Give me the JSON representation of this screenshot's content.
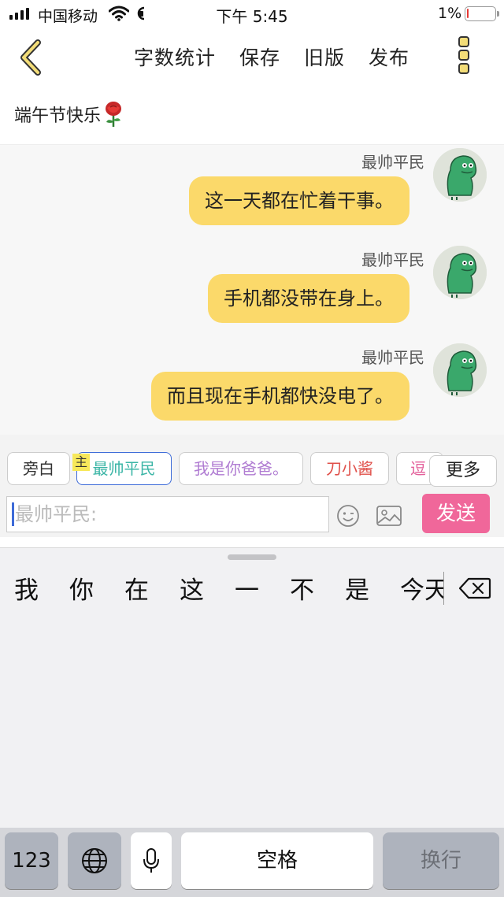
{
  "status_bar": {
    "carrier": "中国移动",
    "time": "下午 5:45",
    "battery_percent": "1%",
    "battery_level": 0.01,
    "rotation_lock_icon": "rotation-lock-icon",
    "wifi_icon": "wifi-icon",
    "signal_icon": "signal-icon"
  },
  "nav": {
    "back_icon": "chevron-left-icon",
    "actions": [
      "字数统计",
      "保存",
      "旧版",
      "发布"
    ],
    "more_icon": "more-vertical-icon",
    "accent": "#f3dd78"
  },
  "title": {
    "text": "端午节快乐",
    "emoji_icon": "rose-icon"
  },
  "messages": [
    {
      "sender": "最帅平民",
      "text": "这一天都在忙着干事。"
    },
    {
      "sender": "最帅平民",
      "text": "手机都没带在身上。"
    },
    {
      "sender": "最帅平民",
      "text": "而且现在手机都快没电了。"
    }
  ],
  "roles": {
    "badge": "主",
    "items": [
      {
        "label": "旁白",
        "color": "#333333"
      },
      {
        "label": "最帅平民",
        "color": "#3bb5a6"
      },
      {
        "label": "我是你爸爸。",
        "color": "#b07cd2"
      },
      {
        "label": "刀小酱",
        "color": "#e0504a"
      },
      {
        "label": "逗",
        "color": "#e35f9a"
      }
    ],
    "more_label": "更多"
  },
  "composer": {
    "placeholder": "最帅平民:",
    "send_label": "发送",
    "send_color": "#f0679a",
    "emoji_icon": "smiley-icon",
    "image_icon": "image-icon"
  },
  "keyboard": {
    "candidates": [
      "我",
      "你",
      "在",
      "这",
      "一",
      "不",
      "是",
      "今天"
    ],
    "backspace_icon": "backspace-icon",
    "keys": {
      "numbers": "123",
      "globe_icon": "globe-icon",
      "mic_icon": "microphone-icon",
      "space": "空格",
      "return": "换行"
    }
  }
}
